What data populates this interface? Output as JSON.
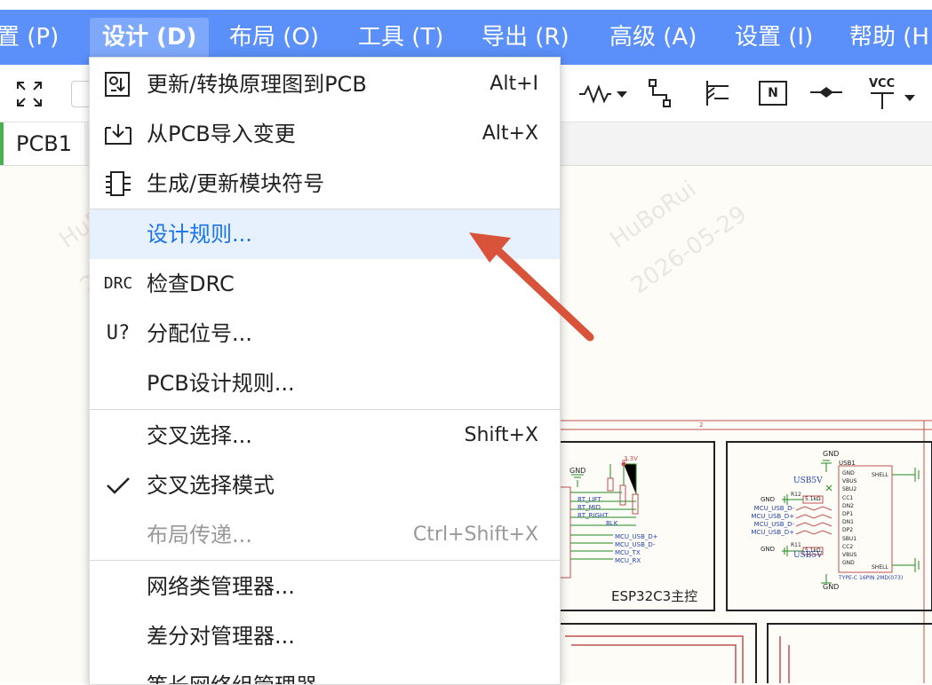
{
  "menubar": {
    "items": [
      {
        "label": "置 (P)"
      },
      {
        "label": "设计 (D)"
      },
      {
        "label": "布局 (O)"
      },
      {
        "label": "工具 (T)"
      },
      {
        "label": "导出 (R)"
      },
      {
        "label": "高级 (A)"
      },
      {
        "label": "设置 (I)"
      },
      {
        "label": "帮助 (H"
      }
    ]
  },
  "toolbar": {
    "vcc_label": "VCC",
    "n_label": "N"
  },
  "tab": {
    "label": "PCB1"
  },
  "design_menu": {
    "items": [
      {
        "label": "更新/转换原理图到PCB",
        "shortcut": "Alt+I",
        "icon": "update-pcb-icon"
      },
      {
        "label": "从PCB导入变更",
        "shortcut": "Alt+X",
        "icon": "import-icon"
      },
      {
        "label": "生成/更新模块符号",
        "shortcut": "",
        "icon": "module-symbol-icon"
      },
      {
        "label": "设计规则...",
        "shortcut": "",
        "icon": ""
      },
      {
        "label": "检查DRC",
        "shortcut": "",
        "icon": "drc-icon",
        "icon_text": "DRC"
      },
      {
        "label": "分配位号...",
        "shortcut": "",
        "icon": "annotate-icon",
        "icon_text": "U?"
      },
      {
        "label": "PCB设计规则...",
        "shortcut": "",
        "icon": ""
      },
      {
        "label": "交叉选择...",
        "shortcut": "Shift+X",
        "icon": ""
      },
      {
        "label": "交叉选择模式",
        "shortcut": "",
        "icon": "check-icon"
      },
      {
        "label": "布局传递...",
        "shortcut": "Ctrl+Shift+X",
        "icon": ""
      },
      {
        "label": "网络类管理器...",
        "shortcut": "",
        "icon": ""
      },
      {
        "label": "差分对管理器...",
        "shortcut": "",
        "icon": ""
      },
      {
        "label": "等长网络组管理器",
        "shortcut": "",
        "icon": ""
      }
    ]
  },
  "schematic": {
    "block1_title": "ESP32C3主控",
    "gnd": "GND",
    "v33": "3.3V",
    "usb5v": "USB5V",
    "usb1": "USB1",
    "type_c": "TYPE-C 16PIN 2MD(073)",
    "nets_left": [
      "BT_LIFT",
      "BT_MID",
      "BT_RIGHT",
      "BLK",
      "MCU_USB_D+",
      "MCU_USB_D-",
      "MCU_TX",
      "MCU_RX"
    ],
    "nets_right": [
      "MCU_USB_D-",
      "MCU_USB_D+",
      "MCU_USB_D-",
      "MCU_USB_D+"
    ],
    "pins_right": [
      "GND",
      "VBUS",
      "SBU2",
      "CC1",
      "DN2",
      "DP1",
      "DN1",
      "DP2",
      "SBU1",
      "CC2",
      "VBUS",
      "GND"
    ],
    "shell": "SHELL",
    "ref_r12": "R12",
    "ref_r11": "R11",
    "val_5k1": "5.1kΩ",
    "grid_2": "2"
  },
  "watermark": {
    "name": "HuBoRui",
    "date": "2026-05-29"
  }
}
